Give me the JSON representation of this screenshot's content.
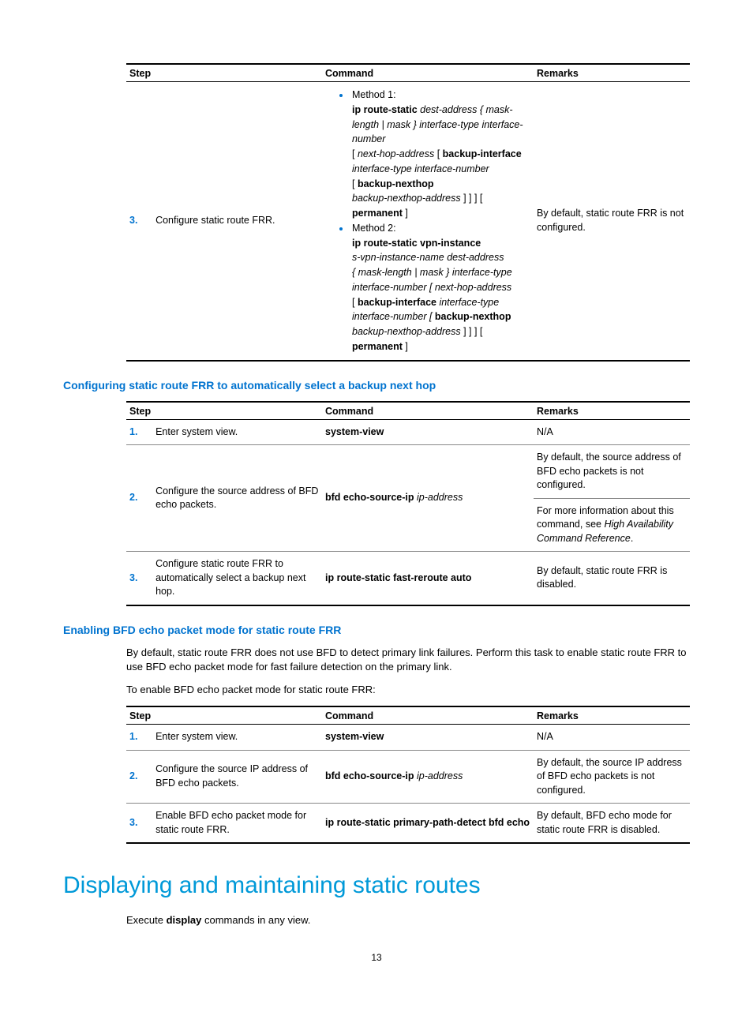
{
  "table1": {
    "headers": {
      "step": "Step",
      "command": "Command",
      "remarks": "Remarks"
    },
    "row3": {
      "num": "3.",
      "desc": "Configure static route FRR.",
      "method1_label": "Method 1:",
      "m1_l1a": "ip route-static ",
      "m1_l1b": "dest-address { mask-length | mask } interface-type interface-number",
      "m1_l2a": "[ ",
      "m1_l2b": "next-hop-address",
      "m1_l2c": " [ ",
      "m1_l2d": "backup-interface",
      "m1_l3": "interface-type interface-number",
      "m1_l4a": "[ ",
      "m1_l4b": "backup-nexthop",
      "m1_l5a": "backup-nexthop-address",
      "m1_l5b": " ] ] ] [ ",
      "m1_l5c": "permanent",
      "m1_l5d": " ]",
      "method2_label": "Method 2:",
      "m2_l1": "ip route-static vpn-instance",
      "m2_l2": "s-vpn-instance-name dest-address",
      "m2_l3": "{ mask-length | mask } interface-type interface-number [ next-hop-address",
      "m2_l4a": "[ ",
      "m2_l4b": "backup-interface",
      "m2_l4c": " interface-type interface-number [ ",
      "m2_l4d": "backup-nexthop",
      "m2_l5a": "backup-nexthop-address",
      "m2_l5b": " ] ] ] [ ",
      "m2_l5c": "permanent",
      "m2_l5d": " ]",
      "remarks": "By default, static route FRR is not configured."
    }
  },
  "section2_title": "Configuring static route FRR to automatically select a backup next hop",
  "table2": {
    "headers": {
      "step": "Step",
      "command": "Command",
      "remarks": "Remarks"
    },
    "row1": {
      "num": "1.",
      "desc": "Enter system view.",
      "cmd": "system-view",
      "remarks": "N/A"
    },
    "row2": {
      "num": "2.",
      "desc": "Configure the source address of BFD echo packets.",
      "cmd_b": "bfd echo-source-ip ",
      "cmd_i": "ip-address",
      "remarks1": "By default, the source address of BFD echo packets is not configured.",
      "remarks2a": "For more information about this command, see ",
      "remarks2b": "High Availability Command Reference",
      "remarks2c": "."
    },
    "row3": {
      "num": "3.",
      "desc": "Configure static route FRR to automatically select a backup next hop.",
      "cmd": "ip route-static fast-reroute auto",
      "remarks": "By default, static route FRR is disabled."
    }
  },
  "section3_title": "Enabling BFD echo packet mode for static route FRR",
  "section3_p1": "By default, static route FRR does not use BFD to detect primary link failures. Perform this task to enable static route FRR to use BFD echo packet mode for fast failure detection on the primary link.",
  "section3_p2": "To enable BFD echo packet mode for static route FRR:",
  "table3": {
    "headers": {
      "step": "Step",
      "command": "Command",
      "remarks": "Remarks"
    },
    "row1": {
      "num": "1.",
      "desc": "Enter system view.",
      "cmd": "system-view",
      "remarks": "N/A"
    },
    "row2": {
      "num": "2.",
      "desc": "Configure the source IP address of BFD echo packets.",
      "cmd_b": "bfd echo-source-ip ",
      "cmd_i": "ip-address",
      "remarks": "By default, the source IP address of BFD echo packets is not configured."
    },
    "row3": {
      "num": "3.",
      "desc": "Enable BFD echo packet mode for static route FRR.",
      "cmd": "ip route-static primary-path-detect bfd echo",
      "remarks": "By default, BFD echo mode for static route FRR is disabled."
    }
  },
  "big_heading": "Displaying and maintaining static routes",
  "last_para_a": "Execute ",
  "last_para_b": "display",
  "last_para_c": " commands in any view.",
  "page_number": "13"
}
